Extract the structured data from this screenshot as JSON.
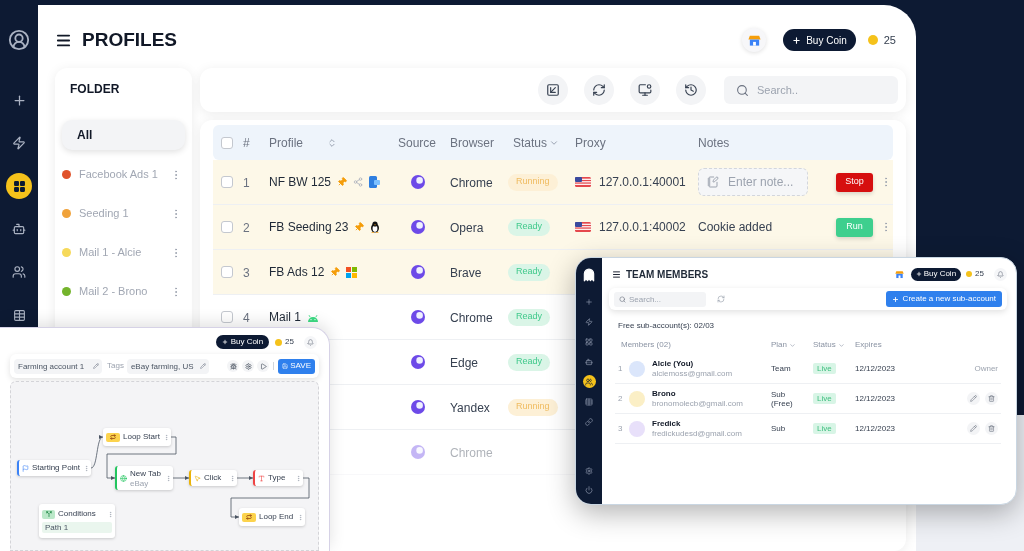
{
  "sidebar": {
    "items": [
      {
        "selected": false
      },
      {
        "selected": false
      },
      {
        "selected": false
      },
      {
        "selected": true
      },
      {
        "selected": false
      },
      {
        "selected": false
      },
      {
        "selected": false
      }
    ]
  },
  "header": {
    "title": "PROFILES",
    "buy_coin": "Buy Coin",
    "coins": "25"
  },
  "folder": {
    "title": "FOLDER",
    "items": [
      {
        "label": "All",
        "selected": true
      },
      {
        "label": "Facebook Ads 1",
        "color": "#e0522b",
        "selected": false
      },
      {
        "label": "Seeding 1",
        "color": "#f0a23a",
        "selected": false
      },
      {
        "label": "Mail 1 - Alcie",
        "color": "#f6d95a",
        "selected": false
      },
      {
        "label": "Mail 2 - Brono",
        "color": "#74b42c",
        "selected": false
      }
    ]
  },
  "toolbar": {
    "search": {
      "placeholder": "Search.."
    }
  },
  "table": {
    "select_all": {
      "checked": false
    },
    "columns": [
      {
        "label": "#",
        "kind": "plain"
      },
      {
        "label": "Profile",
        "kind": "sortable"
      },
      {
        "label": "Source",
        "kind": "plain"
      },
      {
        "label": "Browser",
        "kind": "plain"
      },
      {
        "label": "Status",
        "kind": "dropdown"
      },
      {
        "label": "Proxy",
        "kind": "plain"
      },
      {
        "label": "Notes",
        "kind": "plain"
      }
    ],
    "rows": [
      {
        "checked": false,
        "number": "1",
        "profile": "NF BW 125",
        "highlighted": true,
        "faded": false,
        "icons": [
          {
            "kind": "pin"
          },
          {
            "kind": "share"
          },
          {
            "kind": "app"
          }
        ],
        "browser": "Chrome",
        "status": {
          "label": "Running",
          "kind": "running"
        },
        "proxy": "127.0.0.1:40001",
        "notes": {
          "placeholder": "Enter note..."
        },
        "action": {
          "label": "Stop",
          "kind": "stop"
        }
      },
      {
        "checked": false,
        "number": "2",
        "profile": "FB Seeding 23",
        "highlighted": true,
        "faded": false,
        "icons": [
          {
            "kind": "pin"
          },
          {
            "kind": "linux"
          }
        ],
        "browser": "Opera",
        "status": {
          "label": "Ready",
          "kind": "ready"
        },
        "proxy": "127.0.0.1:40002",
        "notes": {
          "value": "Cookie added"
        },
        "action": {
          "label": "Run",
          "kind": "run"
        }
      },
      {
        "checked": false,
        "number": "3",
        "profile": "FB Ads 12",
        "highlighted": true,
        "faded": false,
        "icons": [
          {
            "kind": "pin"
          },
          {
            "kind": "windows"
          }
        ],
        "browser": "Brave",
        "status": {
          "label": "Ready",
          "kind": "ready"
        }
      },
      {
        "checked": false,
        "number": "4",
        "profile": "Mail 1",
        "highlighted": false,
        "faded": false,
        "icons": [
          {
            "kind": "android"
          }
        ],
        "browser": "Chrome",
        "status": {
          "label": "Ready",
          "kind": "ready"
        }
      },
      {
        "highlighted": false,
        "faded": false,
        "browser": "Edge",
        "status": {
          "label": "Ready",
          "kind": "ready"
        }
      },
      {
        "highlighted": false,
        "faded": false,
        "browser": "Yandex",
        "status": {
          "label": "Running",
          "kind": "running"
        }
      },
      {
        "highlighted": false,
        "faded": true,
        "browser": "Chrome"
      }
    ]
  },
  "team_window": {
    "sidebar": {
      "items": [
        {
          "selected": false
        },
        {
          "selected": false
        },
        {
          "selected": false
        },
        {
          "selected": false
        },
        {
          "selected": true
        },
        {
          "selected": false
        },
        {
          "selected": false
        }
      ],
      "footer_items": [
        {
          "selected": false
        },
        {
          "selected": false
        }
      ]
    },
    "title": "TEAM MEMBERS",
    "buy_coin": "Buy Coin",
    "coins": "25",
    "search": {
      "placeholder": "Search..."
    },
    "create_button": "Create a new sub-account",
    "quota": "Free sub-account(s): 02/03",
    "columns": [
      {
        "label": "Members (02)",
        "kind": "plain"
      },
      {
        "label": "Plan",
        "kind": "dropdown"
      },
      {
        "label": "Status",
        "kind": "dropdown"
      },
      {
        "label": "Expires",
        "kind": "plain"
      }
    ],
    "rows": [
      {
        "number": "1",
        "color": "#dbe6fb",
        "name": "Alcie (You)",
        "email": "alciemoss@gmail.com",
        "plan": "Team",
        "status": "Live",
        "expires": "12/12/2023",
        "role": "Owner",
        "editable": false
      },
      {
        "number": "2",
        "color": "#fbefc6",
        "name": "Brono",
        "email": "bronomolecb@gmail.com",
        "plan": "Sub (Free)",
        "status": "Live",
        "expires": "12/12/2023",
        "editable": true
      },
      {
        "number": "3",
        "color": "#e8e0fa",
        "name": "Fredick",
        "email": "fredickudesd@gmail.com",
        "plan": "Sub",
        "status": "Live",
        "expires": "12/12/2023",
        "editable": true
      }
    ]
  },
  "flow_window": {
    "buy_coin": "Buy Coin",
    "coins": "25",
    "name_field": {
      "value": "Farming account 1"
    },
    "tags_label": "Tags",
    "tags_field": {
      "value": "eBay farming, US"
    },
    "save_button": "SAVE",
    "nodes": [
      {
        "title": "Starting Point",
        "kind": "start"
      },
      {
        "title": "Loop Start",
        "kind": "loop"
      },
      {
        "title": "New Tab",
        "subtitle": "eBay",
        "kind": "tab"
      },
      {
        "title": "Click",
        "kind": "click"
      },
      {
        "title": "Type",
        "kind": "type"
      },
      {
        "title": "Loop End",
        "kind": "loop"
      },
      {
        "title": "Conditions",
        "kind": "condition",
        "paths": [
          "Path 1"
        ]
      }
    ]
  }
}
